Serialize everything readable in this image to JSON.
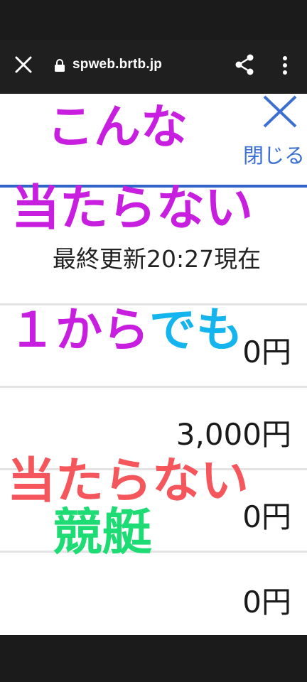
{
  "browser": {
    "url": "spweb.brtb.jp",
    "icons": [
      "close-icon",
      "lock-icon",
      "share-icon",
      "more-vert-icon"
    ]
  },
  "page": {
    "close_label": "閉じる",
    "last_updated": "最終更新20:27現在",
    "amounts": [
      "0円",
      "3,000円",
      "0円",
      "0円"
    ],
    "link_color": "#3b6fd1"
  },
  "overlay_text": {
    "line1": "こんな",
    "line2": "当たらない",
    "line3a": "１から",
    "line3b": "でも",
    "line4": "当たらない",
    "line5": "競艇",
    "colors": {
      "purple": "#c81ee0",
      "cyan": "#14b4ee",
      "red": "#f4565c",
      "green": "#1edc74"
    }
  }
}
